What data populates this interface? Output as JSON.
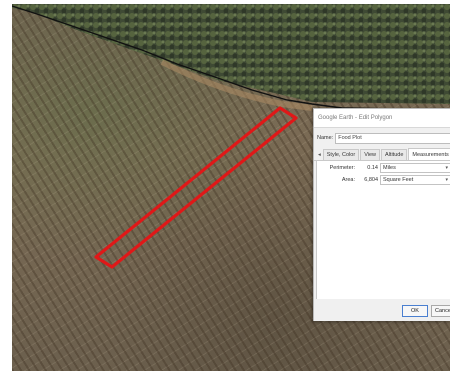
{
  "dialog": {
    "title": "Google Earth - Edit Polygon",
    "name_label": "Name:",
    "name_value": "Food Plot",
    "tabs": [
      "Style, Color",
      "View",
      "Altitude",
      "Measurements"
    ],
    "tab_scroll_glyph": "◂",
    "active_tab": "Measurements",
    "measurements": [
      {
        "label": "Perimeter:",
        "value": "0.14",
        "unit": "Miles"
      },
      {
        "label": "Area:",
        "value": "6,804",
        "unit": "Square Feet"
      }
    ],
    "ok_label": "OK",
    "cancel_label": "Cancel"
  },
  "map": {
    "polygon_color": "#e01818",
    "boundary_line_color": "#111111"
  }
}
